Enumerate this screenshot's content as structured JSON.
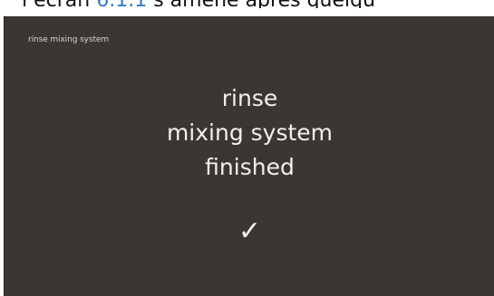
{
  "caption": {
    "prefix": "l’écran",
    "link": "6.1.1",
    "suffix": "s’amène après quelqu"
  },
  "screen": {
    "header_title": "rinse mixing system",
    "message_lines": [
      "rinse",
      "mixing system",
      "finished"
    ],
    "status_icon": "checkmark-icon",
    "status_glyph": "✓"
  },
  "colors": {
    "screen_background": "#3a3632",
    "text": "#f2f0ec",
    "link": "#3a78c0"
  }
}
